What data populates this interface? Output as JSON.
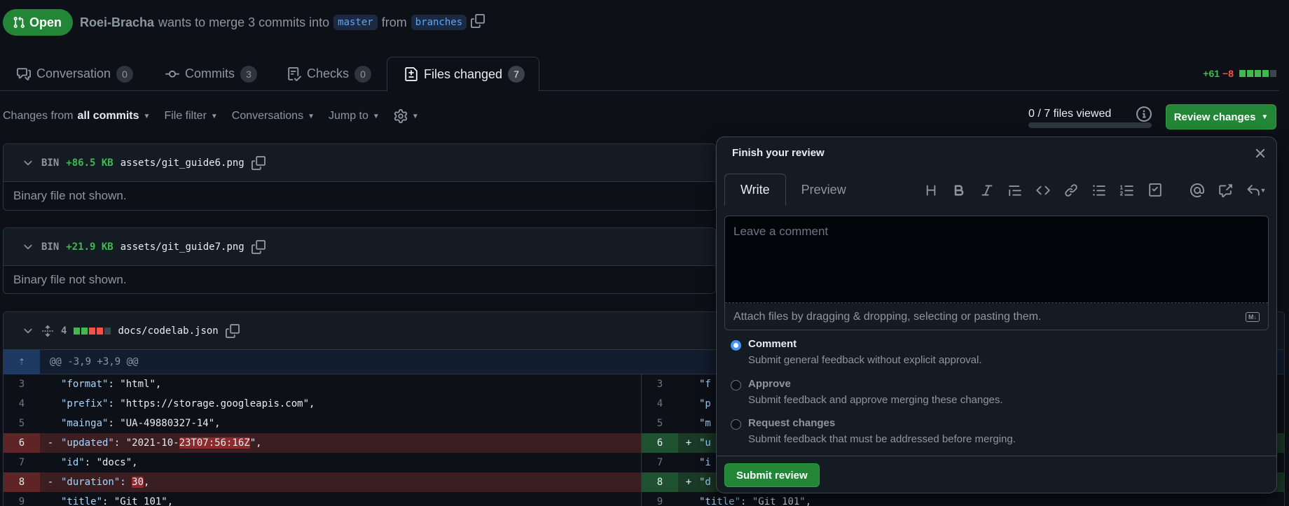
{
  "header": {
    "state": "Open",
    "author": "Roei-Bracha",
    "merge_text": "wants to merge 3 commits into",
    "base_branch": "master",
    "from_text": "from",
    "head_branch": "branches"
  },
  "tabs": [
    {
      "label": "Conversation",
      "count": "0"
    },
    {
      "label": "Commits",
      "count": "3"
    },
    {
      "label": "Checks",
      "count": "0"
    },
    {
      "label": "Files changed",
      "count": "7"
    }
  ],
  "diffstat": {
    "additions": "+61",
    "deletions": "−8"
  },
  "toolbar": {
    "changes_from": "Changes from",
    "all_commits": "all commits",
    "file_filter": "File filter",
    "conversations": "Conversations",
    "jump_to": "Jump to",
    "files_viewed": "0 / 7 files viewed",
    "files_viewed_fraction": 0,
    "review_changes": "Review changes"
  },
  "files": [
    {
      "type": "BIN",
      "size": "+86.5 KB",
      "path": "assets/git_guide6.png",
      "body": "Binary file not shown."
    },
    {
      "type": "BIN",
      "size": "+21.9 KB",
      "path": "assets/git_guide7.png",
      "body": "Binary file not shown."
    },
    {
      "changes": "4",
      "path": "docs/codelab.json"
    }
  ],
  "diff": {
    "hunk": "@@ -3,9 +3,9 @@",
    "rows": [
      {
        "ln": "3",
        "sign": "",
        "key": "\"format\"",
        "rest": ": \"html\","
      },
      {
        "ln": "4",
        "sign": "",
        "key": "\"prefix\"",
        "rest": ": \"https://storage.googleapis.com\","
      },
      {
        "ln": "5",
        "sign": "",
        "key": "\"mainga\"",
        "rest": ": \"UA-49880327-14\","
      },
      {
        "ln": "6",
        "sign": "-",
        "key": "\"updated\"",
        "rest_pre": ": \"2021-10-",
        "rest_hl": "23T07:56:16Z",
        "rest_post": "\","
      },
      {
        "ln": "7",
        "sign": "",
        "key": "\"id\"",
        "rest": ": \"docs\","
      },
      {
        "ln": "8",
        "sign": "-",
        "key": "\"duration\"",
        "rest_pre": ": ",
        "rest_hl": "30",
        "rest_post": ","
      },
      {
        "ln": "9",
        "sign": "",
        "key": "\"title\"",
        "rest": ": \"Git 101\","
      }
    ],
    "right_rows": [
      {
        "ln": "3",
        "sign": "",
        "text": "\"f"
      },
      {
        "ln": "4",
        "sign": "",
        "text": "\"p"
      },
      {
        "ln": "5",
        "sign": "",
        "text": "\"m"
      },
      {
        "ln": "6",
        "sign": "+",
        "text": "\"u"
      },
      {
        "ln": "7",
        "sign": "",
        "text": "\"i"
      },
      {
        "ln": "8",
        "sign": "+",
        "text": "\"d"
      },
      {
        "ln": "9",
        "sign": "",
        "key": "\"title\"",
        "rest": ": \"Git 101\","
      }
    ]
  },
  "review": {
    "title": "Finish your review",
    "tab_write": "Write",
    "tab_preview": "Preview",
    "placeholder": "Leave a comment",
    "attach": "Attach files by dragging & dropping, selecting or pasting them.",
    "markdown_badge": "M↓",
    "options": [
      {
        "label": "Comment",
        "desc": "Submit general feedback without explicit approval.",
        "checked": true
      },
      {
        "label": "Approve",
        "desc": "Submit feedback and approve merging these changes.",
        "checked": false
      },
      {
        "label": "Request changes",
        "desc": "Submit feedback that must be addressed before merging.",
        "checked": false
      }
    ],
    "submit": "Submit review"
  },
  "colors": {
    "accent_green": "#238636",
    "link_blue": "#58a6ff",
    "add": "#3fb950",
    "del": "#f85149"
  }
}
